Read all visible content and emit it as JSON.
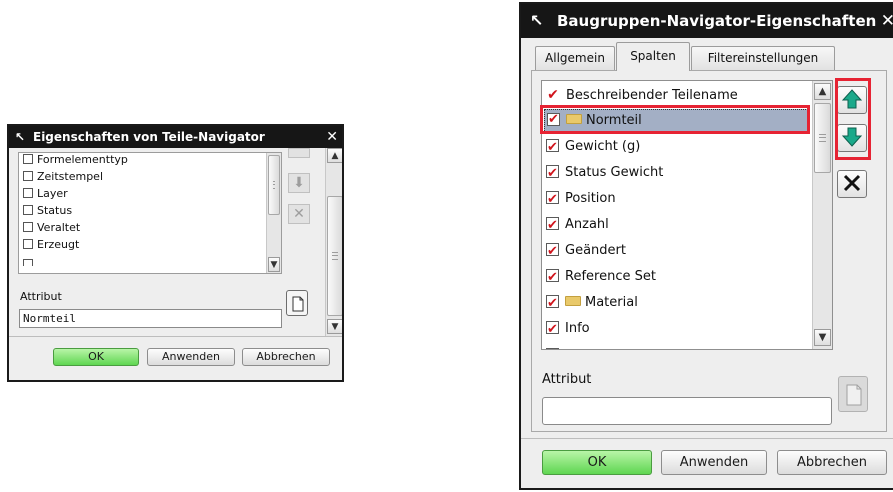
{
  "dialog_small": {
    "title": "Eigenschaften von Teile-Navigator",
    "list_items": [
      "Formelementtyp",
      "Zeitstempel",
      "Layer",
      "Status",
      "Veraltet",
      "Erzeugt"
    ],
    "attribute_label": "Attribut",
    "attribute_value": "Normteil",
    "buttons": {
      "ok": "OK",
      "apply": "Anwenden",
      "cancel": "Abbrechen"
    }
  },
  "dialog_large": {
    "title": "Baugruppen-Navigator-Eigenschaften",
    "tabs": [
      "Allgemein",
      "Spalten",
      "Filtereinstellungen"
    ],
    "active_tab": "Spalten",
    "list_items": [
      "Beschreibender Teilename",
      "Normteil",
      "Gewicht (g)",
      "Status Gewicht",
      "Position",
      "Anzahl",
      "Geändert",
      "Reference Set",
      "Material",
      "Info"
    ],
    "selected_item": "Normteil",
    "attribute_label": "Attribut",
    "attribute_value": "",
    "buttons": {
      "ok": "OK",
      "apply": "Anwenden",
      "cancel": "Abbrechen"
    }
  },
  "colors": {
    "highlight": "#e62333",
    "ok_green": "#5fd651",
    "titlebar": "#161616",
    "selection": "#a3afc5",
    "move_arrow": "#1aa98a"
  },
  "icons": [
    "pin-icon",
    "close-icon",
    "move-up-icon",
    "move-down-icon",
    "delete-icon",
    "new-document-icon",
    "folder-icon",
    "checkmark-icon"
  ]
}
